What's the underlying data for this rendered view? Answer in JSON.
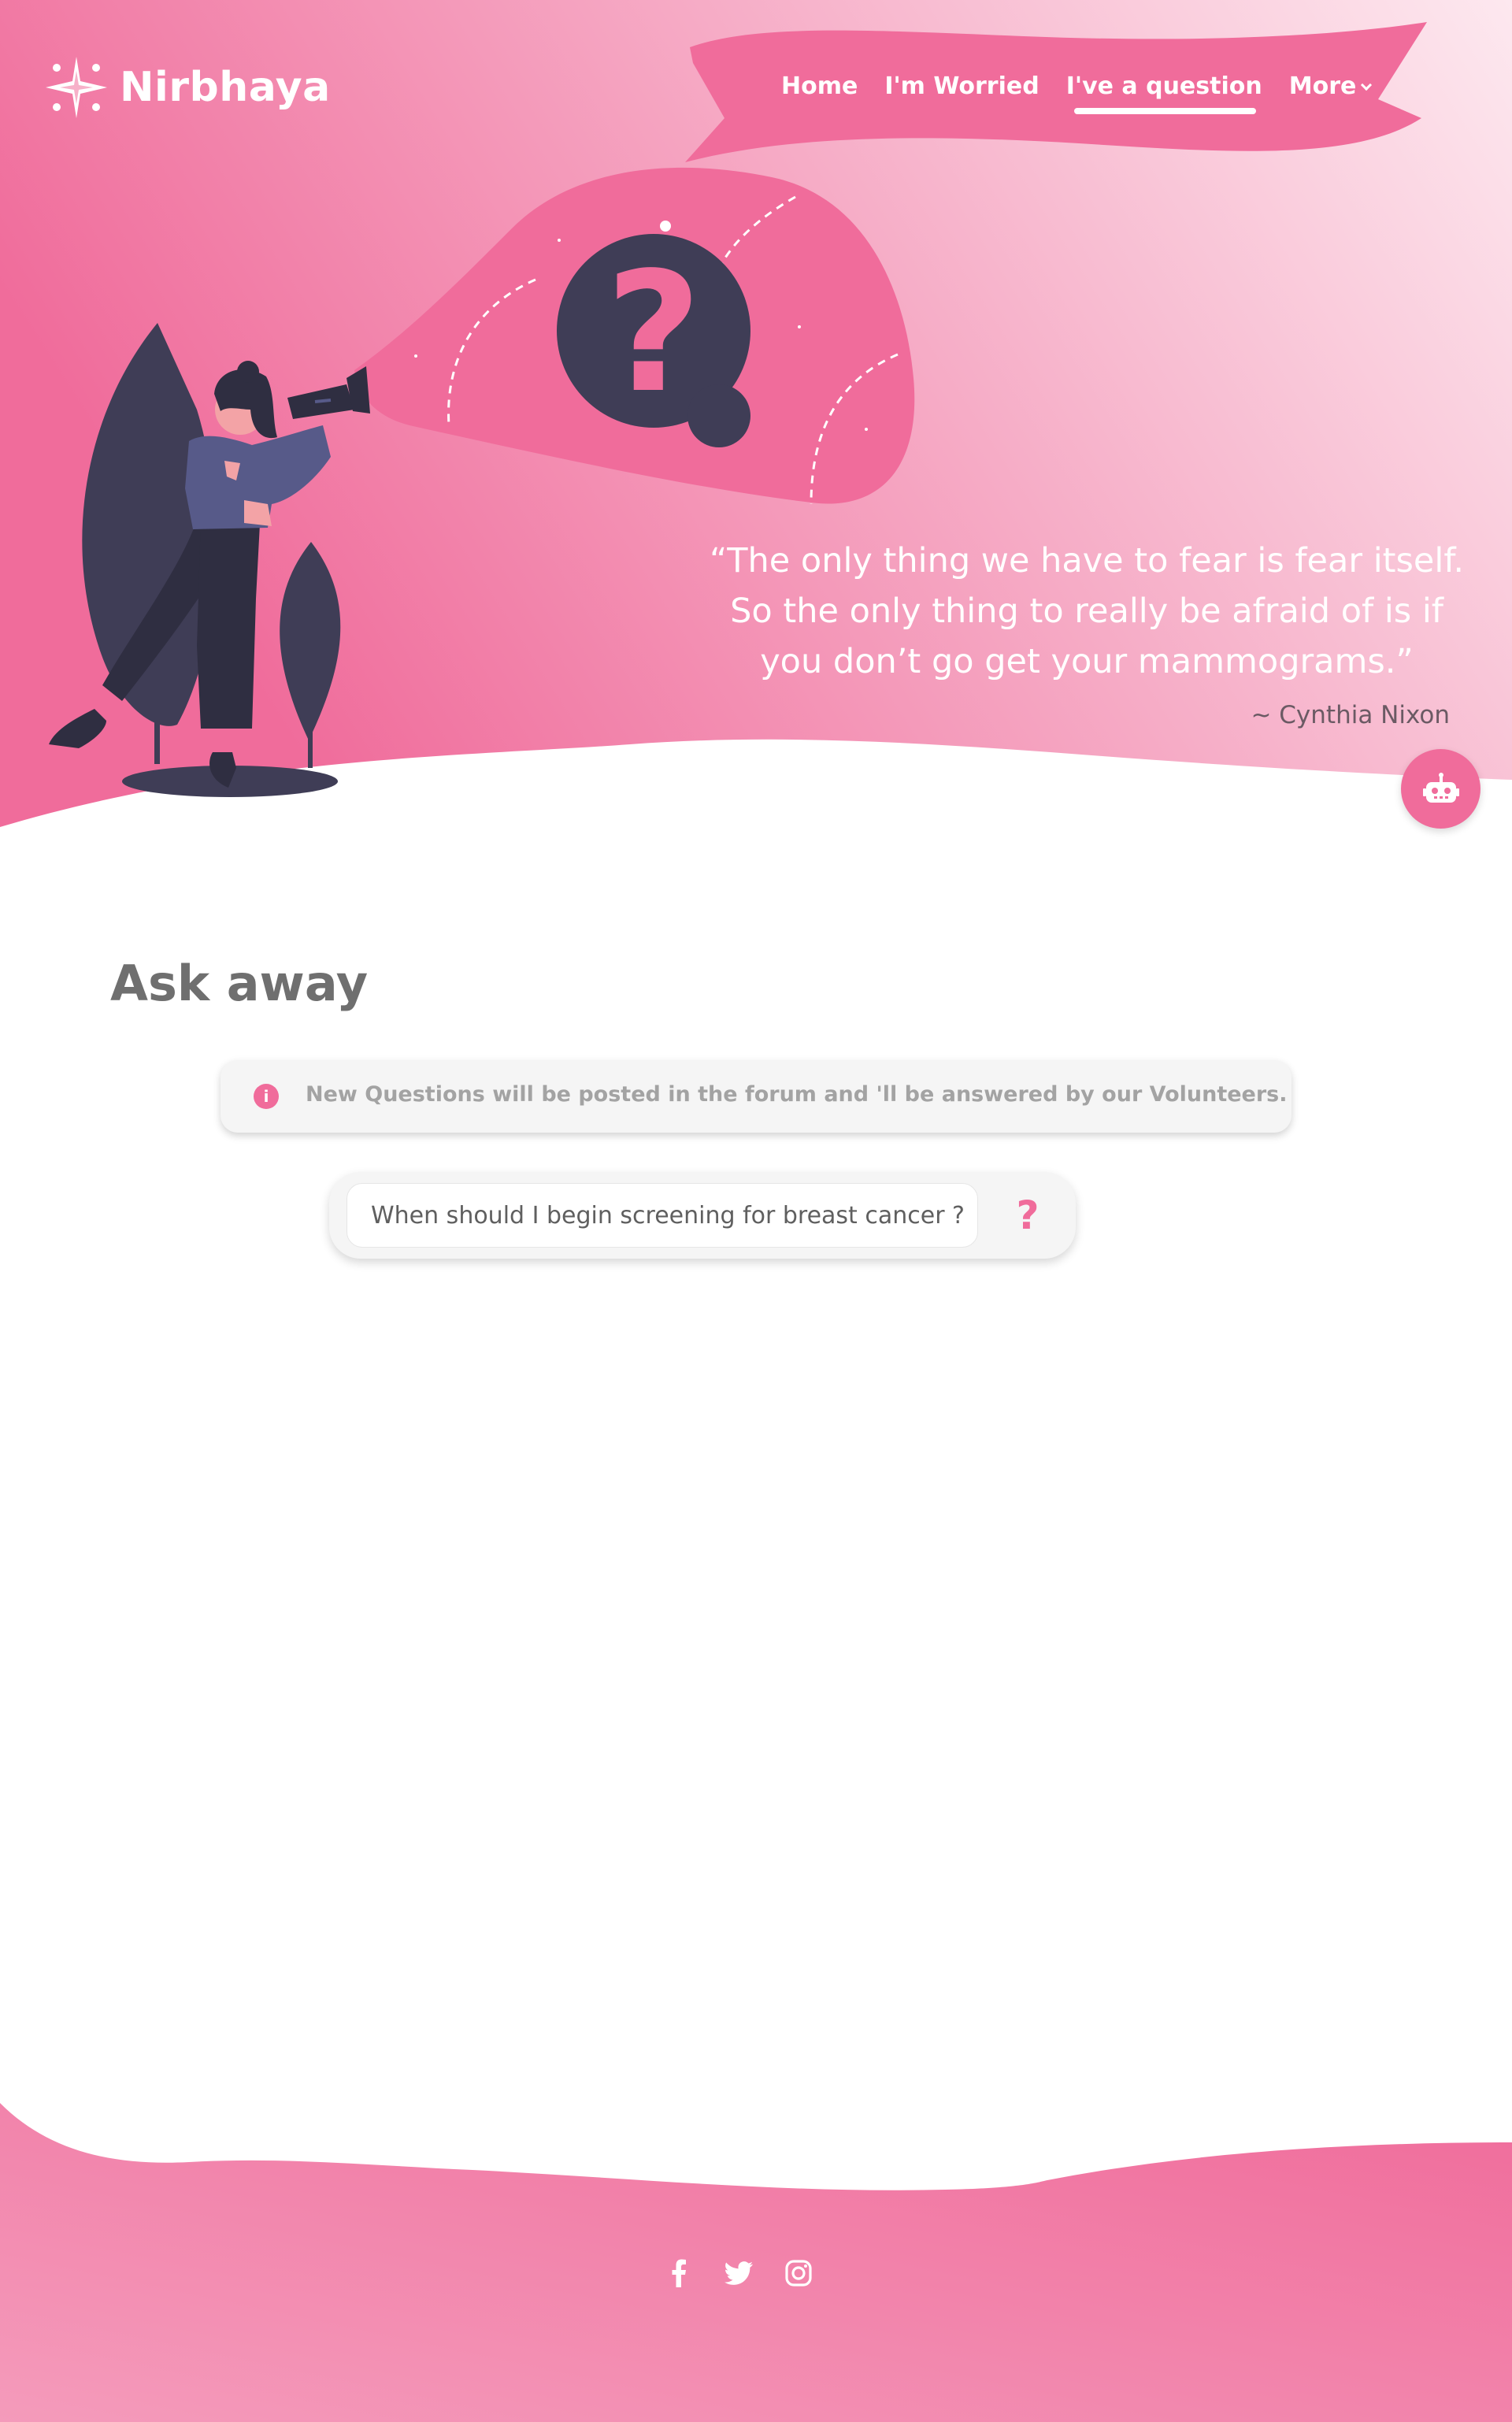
{
  "brand": {
    "name": "Nirbhaya",
    "logo_icon": "star-sparkle-logo-icon"
  },
  "nav": {
    "items": [
      {
        "label": "Home",
        "active": false
      },
      {
        "label": "I'm Worried",
        "active": false
      },
      {
        "label": "I've a question",
        "active": true
      },
      {
        "label": "More",
        "active": false,
        "icon": "chevron-down-icon"
      }
    ]
  },
  "hero": {
    "quote": "“The only thing we have to fear is fear itself. So the only thing to really be afraid of is if you don’t go get your mammograms.”",
    "quote_lines": [
      "“The only thing we have to fear is fear itself.",
      "So the only thing to really be afraid of is if",
      "you don’t go get your mammograms.”"
    ],
    "author": "~ Cynthia Nixon",
    "illustration": "woman-with-flashlight-question-mark",
    "chatbot_icon": "robot-icon"
  },
  "main": {
    "title": "Ask away",
    "notice": "New Questions will be posted in the forum and 'll be answered by our Volunteers.",
    "notice_icon": "info-icon",
    "question_input": {
      "value": "When should I begin screening for breast cancer ?",
      "placeholder": ""
    },
    "ask_button": "?"
  },
  "footer": {
    "socials": [
      "facebook-icon",
      "twitter-icon",
      "instagram-icon"
    ]
  },
  "colors": {
    "primary_pink": "#f06c9b",
    "light_pink": "#fde6ee",
    "dark_navy": "#3f3d56",
    "text_gray": "#6f6f6f"
  }
}
